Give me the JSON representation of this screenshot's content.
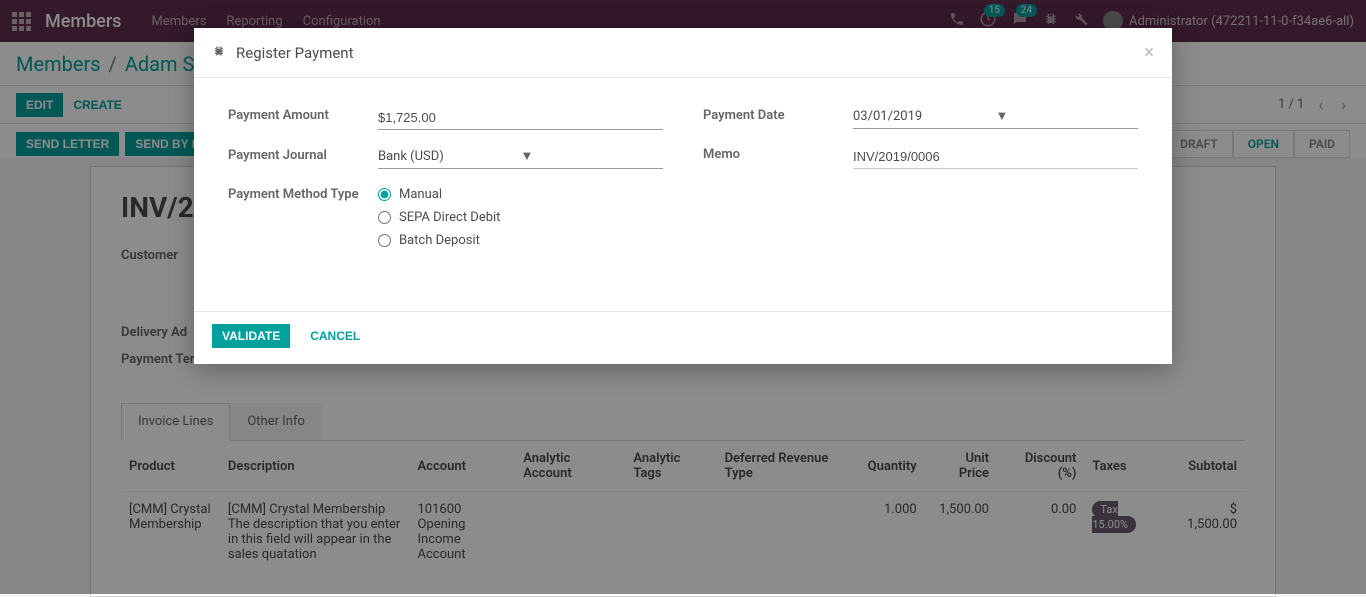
{
  "nav": {
    "title": "Members",
    "links": [
      "Members",
      "Reporting",
      "Configuration"
    ],
    "badges": {
      "phone": "",
      "activity": "15",
      "chat": "24"
    },
    "user": "Administrator (472211-11-0-f34ae6-all)"
  },
  "breadcrumb": {
    "root": "Members",
    "current": "Adam Ste"
  },
  "actions": {
    "edit": "EDIT",
    "create": "CREATE",
    "pager": "1 / 1"
  },
  "sendrow": {
    "send_letter": "SEND LETTER",
    "send_email": "SEND BY EM"
  },
  "status": {
    "draft": "DRAFT",
    "open": "OPEN",
    "paid": "PAID"
  },
  "sheet": {
    "title": "INV/2",
    "customer_label": "Customer",
    "delivery_label": "Delivery Ad",
    "terms_label": "Payment Terms"
  },
  "tabs": {
    "lines": "Invoice Lines",
    "other": "Other Info"
  },
  "table": {
    "headers": {
      "product": "Product",
      "description": "Description",
      "account": "Account",
      "analytic_account": "Analytic Account",
      "analytic_tags": "Analytic Tags",
      "deferred": "Deferred Revenue Type",
      "quantity": "Quantity",
      "unit_price": "Unit Price",
      "discount": "Discount (%)",
      "taxes": "Taxes",
      "subtotal": "Subtotal"
    },
    "rows": [
      {
        "product": "[CMM] Crystal Membership",
        "description": "[CMM] Crystal Membership\nThe description that you enter in this field will appear in the sales quatation",
        "account": "101600 Opening Income Account",
        "quantity": "1.000",
        "unit_price": "1,500.00",
        "discount": "0.00",
        "tax": "Tax 15.00%",
        "subtotal": "$ 1,500.00"
      }
    ]
  },
  "modal": {
    "title": "Register Payment",
    "labels": {
      "amount": "Payment Amount",
      "journal": "Payment Journal",
      "method": "Payment Method Type",
      "date": "Payment Date",
      "memo": "Memo"
    },
    "values": {
      "amount": "$1,725.00",
      "journal": "Bank (USD)",
      "date": "03/01/2019",
      "memo": "INV/2019/0006"
    },
    "methods": {
      "manual": "Manual",
      "sepa": "SEPA Direct Debit",
      "batch": "Batch Deposit"
    },
    "buttons": {
      "validate": "VALIDATE",
      "cancel": "CANCEL"
    }
  }
}
